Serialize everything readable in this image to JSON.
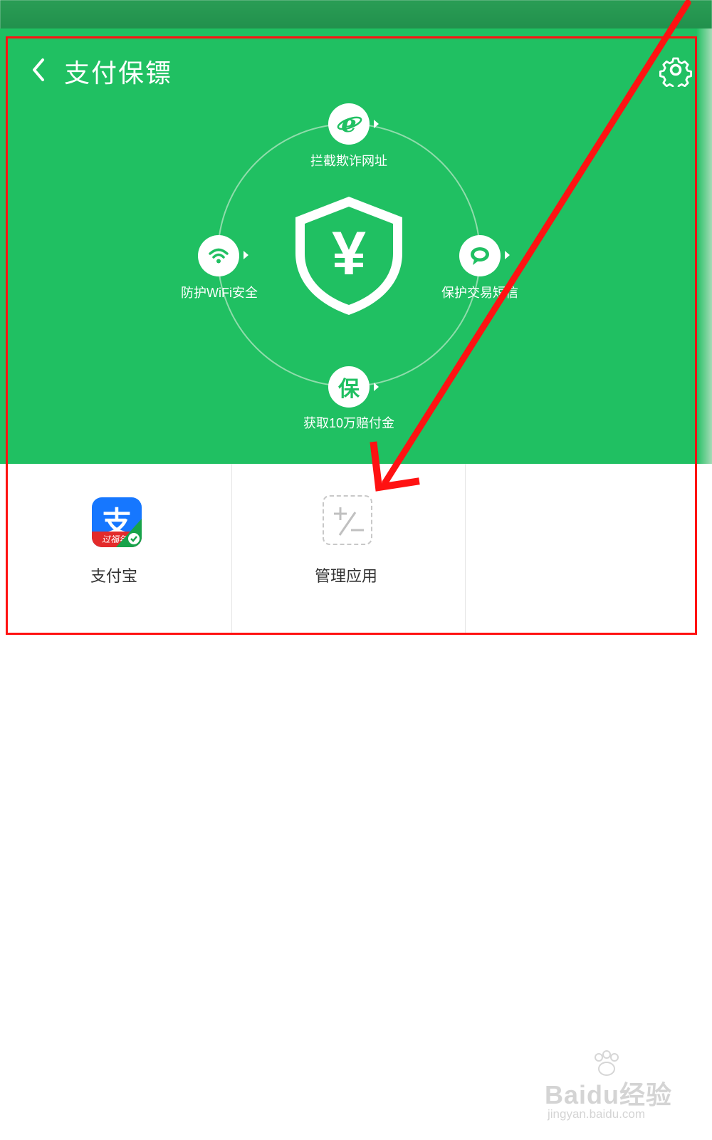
{
  "header": {
    "title": "支付保镖",
    "back_icon": "chevron-left-icon",
    "settings_icon": "gear-icon"
  },
  "shield": {
    "symbol": "¥",
    "icon": "shield-yen-icon"
  },
  "features": [
    {
      "label": "拦截欺诈网址",
      "icon": "browser-e-icon",
      "glyph": "e"
    },
    {
      "label": "防护WiFi安全",
      "icon": "wifi-icon"
    },
    {
      "label": "保护交易短信",
      "icon": "message-bubble-icon"
    },
    {
      "label": "获取10万赔付金",
      "icon": "guarantee-icon",
      "glyph": "保"
    }
  ],
  "apps": [
    {
      "label": "支付宝",
      "icon": "alipay-app-icon",
      "icon_glyph": "支",
      "icon_strip_text": "过福年"
    },
    {
      "label": "管理应用",
      "icon": "plus-minus-icon"
    }
  ],
  "watermark": {
    "main": "Baidu经验",
    "sub": "jingyan.baidu.com"
  },
  "colors": {
    "primary_green": "#20c062",
    "annotation_red": "#ff1212",
    "alipay_blue": "#1677ff",
    "alipay_red": "#e32b2b"
  }
}
